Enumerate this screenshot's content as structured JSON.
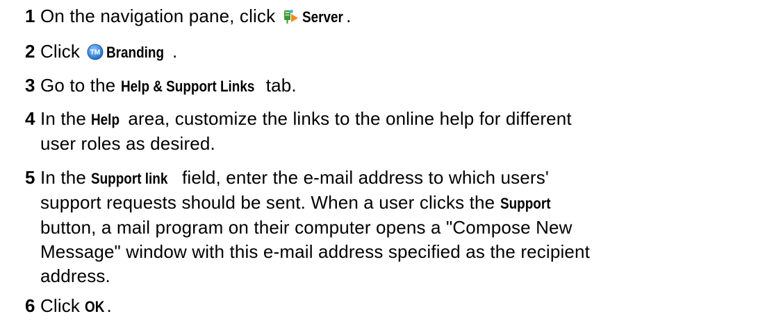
{
  "steps": [
    {
      "number": "1",
      "parts": {
        "a": "On the navigation pane, click ",
        "b": "Server",
        "c": "."
      },
      "icon": "server-icon"
    },
    {
      "number": "2",
      "parts": {
        "a": "Click ",
        "b": "Branding",
        "c": "."
      },
      "icon": "branding-tm-icon"
    },
    {
      "number": "3",
      "parts": {
        "a": "Go to the ",
        "b": "Help & Support Links",
        "c": " tab."
      }
    },
    {
      "number": "4",
      "parts": {
        "a": "In the ",
        "b": "Help",
        "c": " area, customize the links to the online help for different",
        "d": "user roles as desired."
      }
    },
    {
      "number": "5",
      "parts": {
        "a": "In the ",
        "b": "Support link",
        "c": " field, enter the e-mail address to which users'",
        "d": "support requests should be sent. When a user clicks the ",
        "e": "Support",
        "f": "button, a mail program on their computer opens a \"Compose New",
        "g": "Message\" window with this e-mail address specified as the recipient",
        "h": "address."
      }
    },
    {
      "number": "6",
      "parts": {
        "a": "Click ",
        "b": "OK",
        "c": "."
      }
    }
  ],
  "colors": {
    "text": "#000000",
    "background": "#ffffff",
    "server_icon_green": "#3a9a3a",
    "server_icon_orange": "#f28c1a",
    "branding_icon_blue": "#2a7fd4"
  }
}
